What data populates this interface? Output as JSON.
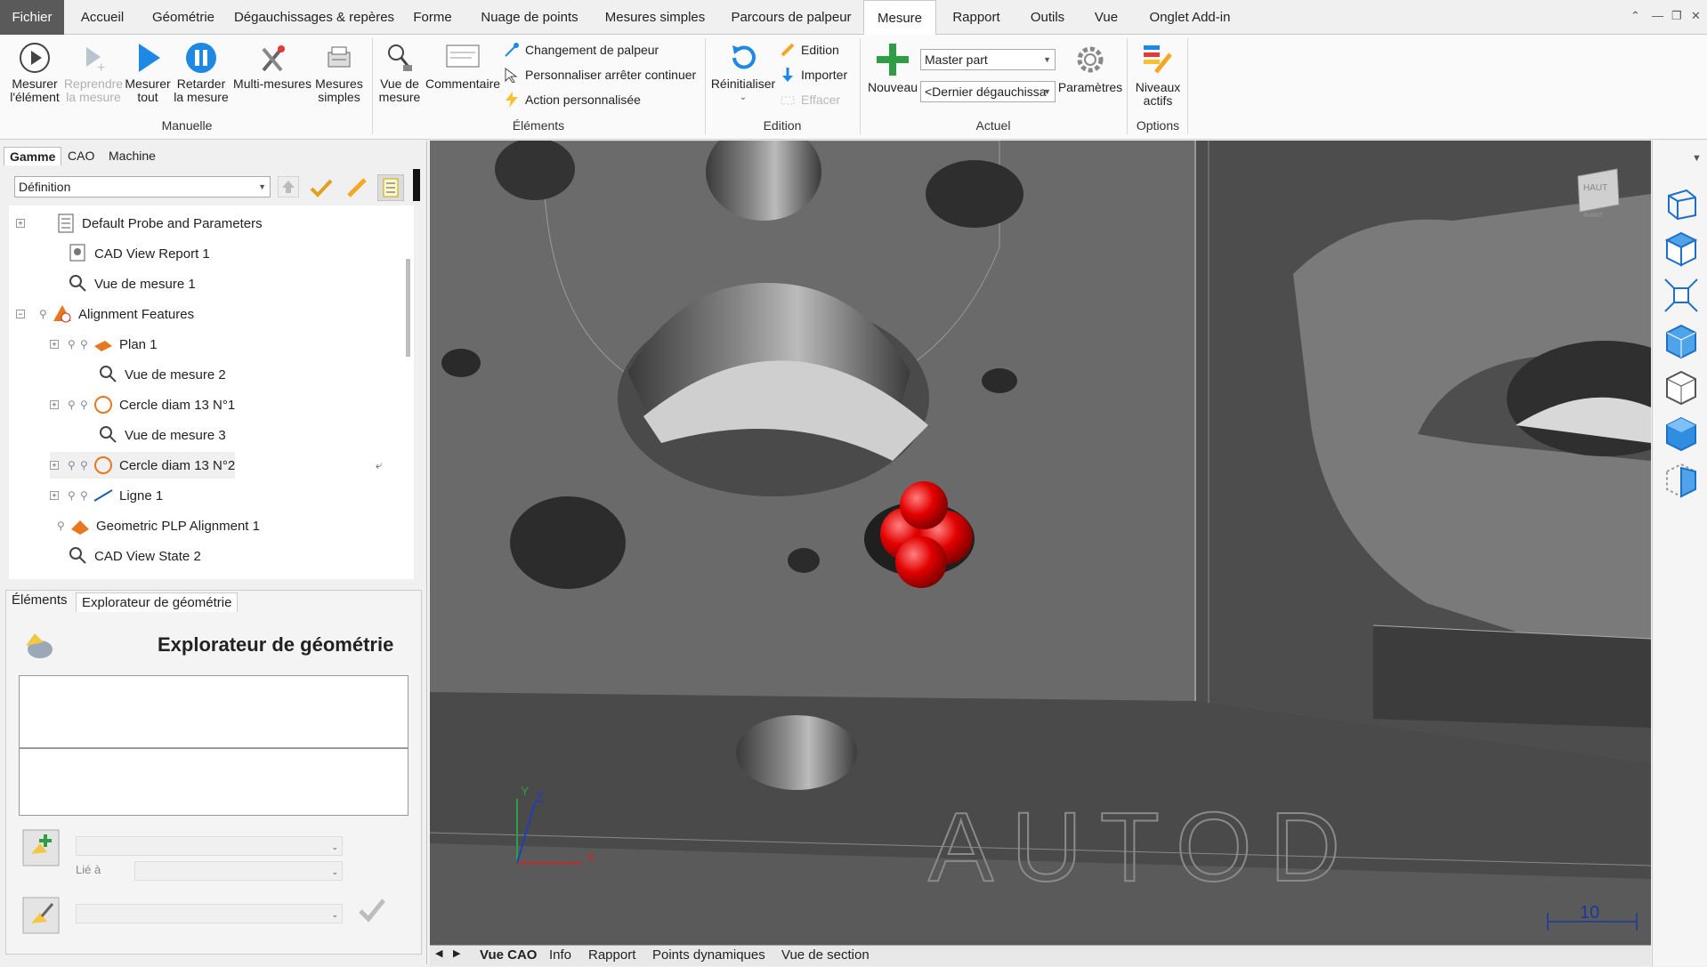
{
  "tabs": [
    "Fichier",
    "Accueil",
    "Géométrie",
    "Dégauchissages & repères",
    "Forme",
    "Nuage de points",
    "Mesures simples",
    "Parcours de palpeur",
    "Mesure",
    "Rapport",
    "Outils",
    "Vue",
    "Onglet Add-in"
  ],
  "active_tab": "Mesure",
  "ribbon": {
    "manuelle": {
      "label": "Manuelle",
      "mesurer_element": "Mesurer l'élément",
      "reprendre": "Reprendre la mesure",
      "mesurer_tout": "Mesurer tout",
      "retarder": "Retarder la mesure",
      "multi": "Multi-mesures",
      "simples": "Mesures simples"
    },
    "elements": {
      "label": "Éléments",
      "vue_mesure": "Vue de mesure",
      "commentaire": "Commentaire",
      "changement": "Changement de palpeur",
      "personnaliser": "Personnaliser arrêter continuer",
      "action": "Action personnalisée"
    },
    "edition": {
      "label": "Edition",
      "reinitialiser": "Réinitialiser",
      "edition": "Edition",
      "importer": "Importer",
      "effacer": "Effacer"
    },
    "actuel": {
      "label": "Actuel",
      "nouveau": "Nouveau",
      "combo1": "Master part",
      "combo2": "<Dernier dégauchissa",
      "parametres": "Paramètres"
    },
    "options": {
      "label": "Options",
      "niveaux": "Niveaux actifs"
    }
  },
  "left": {
    "tabs": [
      "Gamme",
      "CAO",
      "Machine"
    ],
    "definition": "Définition",
    "tree": [
      "Default Probe and Parameters",
      "CAD View Report 1",
      "Vue de mesure 1",
      "Alignment Features",
      "Plan 1",
      "Vue de mesure 2",
      "Cercle diam 13 N°1",
      "Vue de mesure 3",
      "Cercle diam 13 N°2",
      "Ligne 1",
      "Geometric PLP Alignment 1",
      "CAD View State 2"
    ],
    "bottom_tabs": [
      "Éléments",
      "Explorateur de géométrie"
    ],
    "geo_title": "Explorateur de géométrie",
    "lie_a": "Lié à"
  },
  "view_tabs": [
    "Vue CAO",
    "Info",
    "Rapport",
    "Points dynamiques",
    "Vue de section"
  ],
  "view": {
    "scale_value": "10",
    "cube_top": "HAUT",
    "cube_front": "AVANT",
    "watermark": "AUTOD",
    "axis_x": "X",
    "axis_y": "Y",
    "axis_z": "Z"
  }
}
